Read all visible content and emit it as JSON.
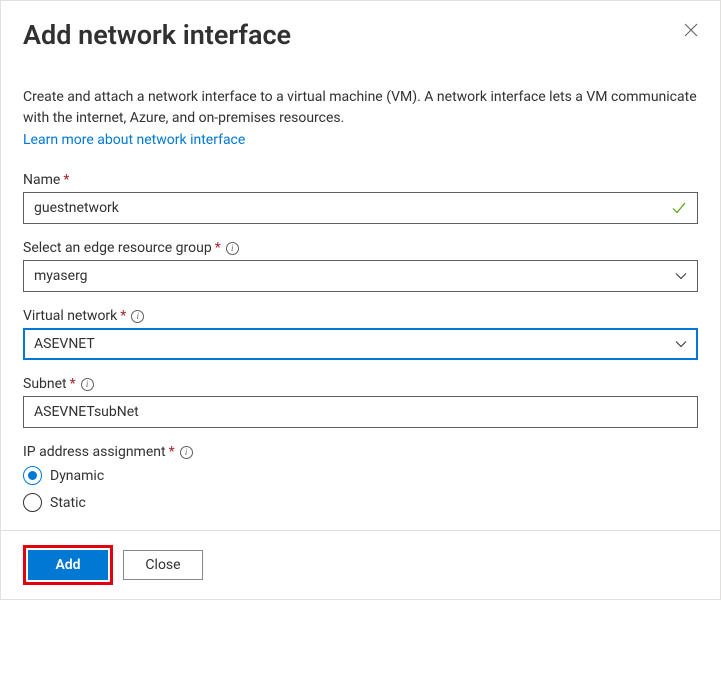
{
  "header": {
    "title": "Add network interface"
  },
  "description": "Create and attach a network interface to a virtual machine (VM). A network interface lets a VM communicate with the internet, Azure, and on-premises resources.",
  "learn_more": "Learn more about network interface",
  "fields": {
    "name": {
      "label": "Name",
      "value": "guestnetwork"
    },
    "resource_group": {
      "label": "Select an edge resource group",
      "value": "myaserg"
    },
    "vnet": {
      "label": "Virtual network",
      "value": "ASEVNET"
    },
    "subnet": {
      "label": "Subnet",
      "value": "ASEVNETsubNet"
    },
    "ip_assignment": {
      "label": "IP address assignment",
      "options": {
        "dynamic": "Dynamic",
        "static": "Static"
      },
      "selected": "dynamic"
    }
  },
  "footer": {
    "add": "Add",
    "close": "Close"
  }
}
